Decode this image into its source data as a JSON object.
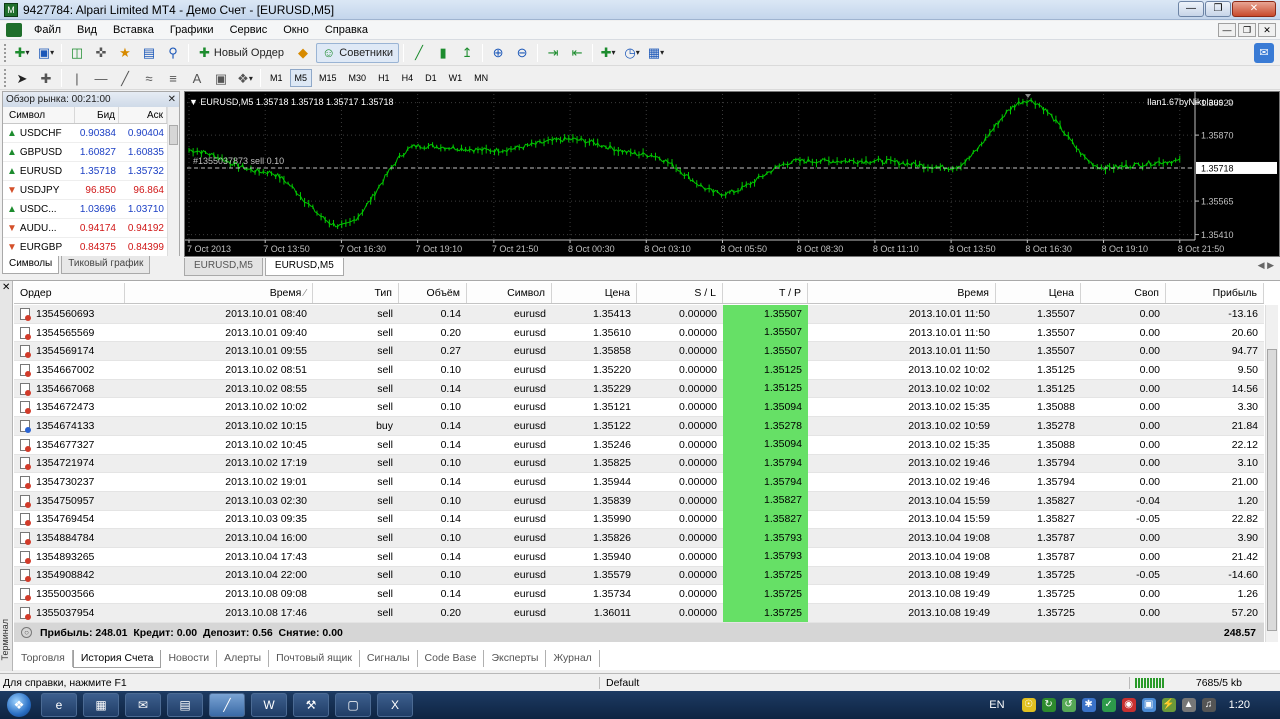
{
  "window": {
    "title": "9427784: Alpari Limited MT4 - Демо Счет - [EURUSD,M5]"
  },
  "menu": [
    "Файл",
    "Вид",
    "Вставка",
    "Графики",
    "Сервис",
    "Окно",
    "Справка"
  ],
  "toolbar": {
    "new_order": "Новый Ордер",
    "advisors": "Советники"
  },
  "timeframes": [
    "M1",
    "M5",
    "M15",
    "M30",
    "H1",
    "H4",
    "D1",
    "W1",
    "MN"
  ],
  "active_timeframe": "M5",
  "market_watch": {
    "title": "Обзор рынка: 00:21:00",
    "headers": {
      "symbol": "Символ",
      "bid": "Бид",
      "ask": "Аск"
    },
    "rows": [
      {
        "symbol": "USDCHF",
        "bid": "0.90384",
        "ask": "0.90404",
        "dir": "up"
      },
      {
        "symbol": "GBPUSD",
        "bid": "1.60827",
        "ask": "1.60835",
        "dir": "up"
      },
      {
        "symbol": "EURUSD",
        "bid": "1.35718",
        "ask": "1.35732",
        "dir": "up"
      },
      {
        "symbol": "USDJPY",
        "bid": "96.850",
        "ask": "96.864",
        "dir": "down"
      },
      {
        "symbol": "USDC...",
        "bid": "1.03696",
        "ask": "1.03710",
        "dir": "up"
      },
      {
        "symbol": "AUDU...",
        "bid": "0.94174",
        "ask": "0.94192",
        "dir": "down"
      },
      {
        "symbol": "EURGBP",
        "bid": "0.84375",
        "ask": "0.84399",
        "dir": "down"
      }
    ],
    "tabs": [
      "Символы",
      "Тиковый график"
    ]
  },
  "chart": {
    "header": "EURUSD,M5  1.35718 1.35718 1.35717 1.35718",
    "ea_label": "Ilan1.67byNikolaus",
    "order_line_label": "#1355037873 sell 0.10",
    "tabs": [
      "EURUSD,M5",
      "EURUSD,M5"
    ]
  },
  "chart_data": {
    "type": "line",
    "price_labels": [
      "1.36020",
      "1.35870",
      "1.35718",
      "1.35565",
      "1.35410"
    ],
    "x_labels": [
      "7 Oct 2013",
      "7 Oct 13:50",
      "7 Oct 16:30",
      "7 Oct 19:10",
      "7 Oct 21:50",
      "8 Oct 00:30",
      "8 Oct 03:10",
      "8 Oct 05:50",
      "8 Oct 08:30",
      "8 Oct 11:10",
      "8 Oct 13:50",
      "8 Oct 16:30",
      "8 Oct 19:10",
      "8 Oct 21:50"
    ],
    "x": [
      "7 Oct 2013",
      "7 Oct 13:50",
      "7 Oct 16:30",
      "7 Oct 19:10",
      "7 Oct 21:50",
      "8 Oct 00:30",
      "8 Oct 03:10",
      "8 Oct 05:50",
      "8 Oct 08:30",
      "8 Oct 11:10",
      "8 Oct 13:50",
      "8 Oct 16:30",
      "8 Oct 19:10",
      "8 Oct 21:50"
    ],
    "series": [
      {
        "values": [
          1.358,
          1.357,
          1.3545,
          1.3582,
          1.358,
          1.3585,
          1.3578,
          1.356,
          1.3575,
          1.3575,
          1.3572,
          1.3603,
          1.3572,
          1.3575
        ]
      }
    ],
    "ylim": [
      1.35385,
      1.3606
    ],
    "current_price": 1.35718,
    "colors": {
      "background": "#000000",
      "line": "#00c800",
      "grid": "#3c3c3c",
      "current": "#c0c0c0"
    }
  },
  "terminal": {
    "headers": {
      "order": "Ордер",
      "time": "Время",
      "type": "Тип",
      "volume": "Объём",
      "symbol": "Символ",
      "price": "Цена",
      "sl": "S / L",
      "tp": "T / P",
      "close_time": "Время",
      "close_price": "Цена",
      "swap": "Своп",
      "profit": "Прибыль"
    },
    "rows": [
      {
        "order": "1354560693",
        "time": "2013.10.01 08:40",
        "type": "sell",
        "volume": "0.14",
        "symbol": "eurusd",
        "price": "1.35413",
        "sl": "0.00000",
        "tp": "1.35507",
        "close_time": "2013.10.01 11:50",
        "close_price": "1.35507",
        "swap": "0.00",
        "profit": "-13.16"
      },
      {
        "order": "1354565569",
        "time": "2013.10.01 09:40",
        "type": "sell",
        "volume": "0.20",
        "symbol": "eurusd",
        "price": "1.35610",
        "sl": "0.00000",
        "tp": "1.35507",
        "close_time": "2013.10.01 11:50",
        "close_price": "1.35507",
        "swap": "0.00",
        "profit": "20.60"
      },
      {
        "order": "1354569174",
        "time": "2013.10.01 09:55",
        "type": "sell",
        "volume": "0.27",
        "symbol": "eurusd",
        "price": "1.35858",
        "sl": "0.00000",
        "tp": "1.35507",
        "close_time": "2013.10.01 11:50",
        "close_price": "1.35507",
        "swap": "0.00",
        "profit": "94.77"
      },
      {
        "order": "1354667002",
        "time": "2013.10.02 08:51",
        "type": "sell",
        "volume": "0.10",
        "symbol": "eurusd",
        "price": "1.35220",
        "sl": "0.00000",
        "tp": "1.35125",
        "close_time": "2013.10.02 10:02",
        "close_price": "1.35125",
        "swap": "0.00",
        "profit": "9.50"
      },
      {
        "order": "1354667068",
        "time": "2013.10.02 08:55",
        "type": "sell",
        "volume": "0.14",
        "symbol": "eurusd",
        "price": "1.35229",
        "sl": "0.00000",
        "tp": "1.35125",
        "close_time": "2013.10.02 10:02",
        "close_price": "1.35125",
        "swap": "0.00",
        "profit": "14.56"
      },
      {
        "order": "1354672473",
        "time": "2013.10.02 10:02",
        "type": "sell",
        "volume": "0.10",
        "symbol": "eurusd",
        "price": "1.35121",
        "sl": "0.00000",
        "tp": "1.35094",
        "close_time": "2013.10.02 15:35",
        "close_price": "1.35088",
        "swap": "0.00",
        "profit": "3.30"
      },
      {
        "order": "1354674133",
        "time": "2013.10.02 10:15",
        "type": "buy",
        "volume": "0.14",
        "symbol": "eurusd",
        "price": "1.35122",
        "sl": "0.00000",
        "tp": "1.35278",
        "close_time": "2013.10.02 10:59",
        "close_price": "1.35278",
        "swap": "0.00",
        "profit": "21.84"
      },
      {
        "order": "1354677327",
        "time": "2013.10.02 10:45",
        "type": "sell",
        "volume": "0.14",
        "symbol": "eurusd",
        "price": "1.35246",
        "sl": "0.00000",
        "tp": "1.35094",
        "close_time": "2013.10.02 15:35",
        "close_price": "1.35088",
        "swap": "0.00",
        "profit": "22.12"
      },
      {
        "order": "1354721974",
        "time": "2013.10.02 17:19",
        "type": "sell",
        "volume": "0.10",
        "symbol": "eurusd",
        "price": "1.35825",
        "sl": "0.00000",
        "tp": "1.35794",
        "close_time": "2013.10.02 19:46",
        "close_price": "1.35794",
        "swap": "0.00",
        "profit": "3.10"
      },
      {
        "order": "1354730237",
        "time": "2013.10.02 19:01",
        "type": "sell",
        "volume": "0.14",
        "symbol": "eurusd",
        "price": "1.35944",
        "sl": "0.00000",
        "tp": "1.35794",
        "close_time": "2013.10.02 19:46",
        "close_price": "1.35794",
        "swap": "0.00",
        "profit": "21.00"
      },
      {
        "order": "1354750957",
        "time": "2013.10.03 02:30",
        "type": "sell",
        "volume": "0.10",
        "symbol": "eurusd",
        "price": "1.35839",
        "sl": "0.00000",
        "tp": "1.35827",
        "close_time": "2013.10.04 15:59",
        "close_price": "1.35827",
        "swap": "-0.04",
        "profit": "1.20"
      },
      {
        "order": "1354769454",
        "time": "2013.10.03 09:35",
        "type": "sell",
        "volume": "0.14",
        "symbol": "eurusd",
        "price": "1.35990",
        "sl": "0.00000",
        "tp": "1.35827",
        "close_time": "2013.10.04 15:59",
        "close_price": "1.35827",
        "swap": "-0.05",
        "profit": "22.82"
      },
      {
        "order": "1354884784",
        "time": "2013.10.04 16:00",
        "type": "sell",
        "volume": "0.10",
        "symbol": "eurusd",
        "price": "1.35826",
        "sl": "0.00000",
        "tp": "1.35793",
        "close_time": "2013.10.04 19:08",
        "close_price": "1.35787",
        "swap": "0.00",
        "profit": "3.90"
      },
      {
        "order": "1354893265",
        "time": "2013.10.04 17:43",
        "type": "sell",
        "volume": "0.14",
        "symbol": "eurusd",
        "price": "1.35940",
        "sl": "0.00000",
        "tp": "1.35793",
        "close_time": "2013.10.04 19:08",
        "close_price": "1.35787",
        "swap": "0.00",
        "profit": "21.42"
      },
      {
        "order": "1354908842",
        "time": "2013.10.04 22:00",
        "type": "sell",
        "volume": "0.10",
        "symbol": "eurusd",
        "price": "1.35579",
        "sl": "0.00000",
        "tp": "1.35725",
        "close_time": "2013.10.08 19:49",
        "close_price": "1.35725",
        "swap": "-0.05",
        "profit": "-14.60"
      },
      {
        "order": "1355003566",
        "time": "2013.10.08 09:08",
        "type": "sell",
        "volume": "0.14",
        "symbol": "eurusd",
        "price": "1.35734",
        "sl": "0.00000",
        "tp": "1.35725",
        "close_time": "2013.10.08 19:49",
        "close_price": "1.35725",
        "swap": "0.00",
        "profit": "1.26"
      },
      {
        "order": "1355037954",
        "time": "2013.10.08 17:46",
        "type": "sell",
        "volume": "0.20",
        "symbol": "eurusd",
        "price": "1.36011",
        "sl": "0.00000",
        "tp": "1.35725",
        "close_time": "2013.10.08 19:49",
        "close_price": "1.35725",
        "swap": "0.00",
        "profit": "57.20"
      }
    ],
    "summary": "Прибыль: 248.01  Кредит: 0.00  Депозит: 0.56  Снятие: 0.00",
    "summary_total": "248.57",
    "side_label": "Терминал",
    "tabs": [
      "Торговля",
      "История Счета",
      "Новости",
      "Алерты",
      "Почтовый ящик",
      "Сигналы",
      "Code Base",
      "Эксперты",
      "Журнал"
    ],
    "active_tab": "История Счета"
  },
  "status": {
    "help": "Для справки, нажмите F1",
    "profile": "Default",
    "traffic": "7685/5 kb"
  },
  "taskbar": {
    "lang": "EN",
    "time": "1:20"
  }
}
